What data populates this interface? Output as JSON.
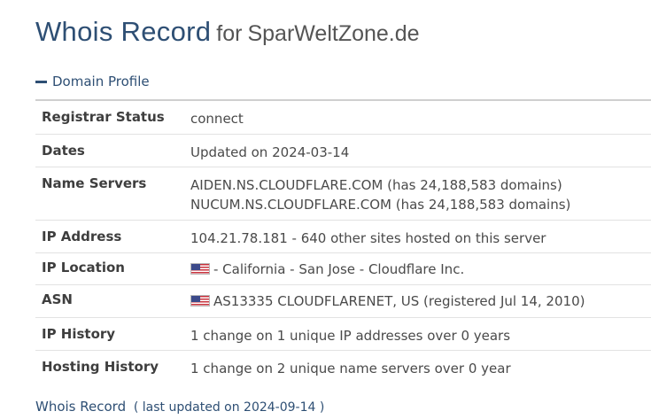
{
  "header": {
    "title": "Whois Record",
    "for_word": "for",
    "domain": "SparWeltZone.de"
  },
  "section": {
    "icon": "minus-icon",
    "label": "Domain Profile"
  },
  "profile": {
    "registrar_status": {
      "label": "Registrar Status",
      "value": "connect"
    },
    "dates": {
      "label": "Dates",
      "value": "Updated on 2024-03-14"
    },
    "name_servers": {
      "label": "Name Servers",
      "values": [
        "AIDEN.NS.CLOUDFLARE.COM (has 24,188,583 domains)",
        "NUCUM.NS.CLOUDFLARE.COM (has 24,188,583 domains)"
      ]
    },
    "ip_address": {
      "label": "IP Address",
      "value": "104.21.78.181 - 640 other sites hosted on this server"
    },
    "ip_location": {
      "label": "IP Location",
      "flag": "us-flag-icon",
      "value": "- California - San Jose - Cloudflare Inc."
    },
    "asn": {
      "label": "ASN",
      "flag": "us-flag-icon",
      "value": "AS13335 CLOUDFLARENET, US (registered Jul 14, 2010)"
    },
    "ip_history": {
      "label": "IP History",
      "value": "1 change on 1 unique IP addresses over 0 years"
    },
    "hosting_history": {
      "label": "Hosting History",
      "value": "1 change on 2 unique name servers over 0 year"
    }
  },
  "footer": {
    "title": "Whois Record",
    "note": "( last updated on 2024-09-14 )"
  },
  "colors": {
    "accent": "#2e4f74",
    "text": "#3a3a3a",
    "border": "#cfcfcf"
  }
}
